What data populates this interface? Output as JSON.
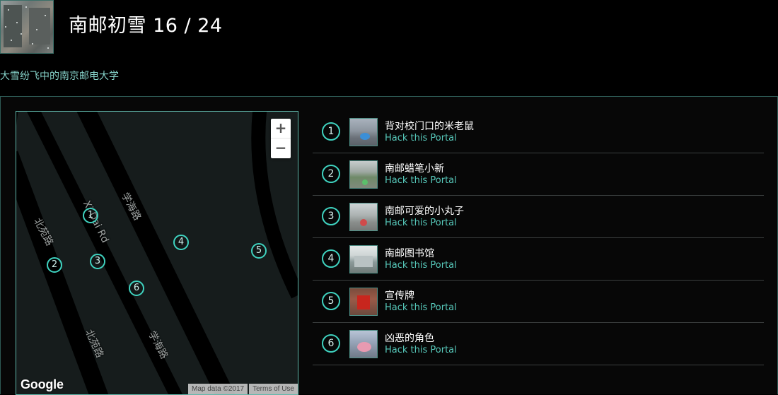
{
  "header": {
    "title": "南邮初雪 16 / 24",
    "subtitle": "大雪纷飞中的南京邮电大学"
  },
  "map": {
    "zoom_in": "+",
    "zoom_out": "−",
    "attribution": "Map data ©2017",
    "terms": "Terms of Use",
    "logo": "Google",
    "road_labels": [
      "北苑路",
      "Xi Dai Rd",
      "学海路",
      "北苑路",
      "学海路"
    ],
    "markers": [
      "1",
      "2",
      "3",
      "4",
      "5",
      "6"
    ],
    "colors": {
      "accent": "#3fd3c0",
      "road": "#000000",
      "land": "#161c1c"
    }
  },
  "portals": [
    {
      "num": "1",
      "name": "背对校门口的米老鼠",
      "link": "Hack this Portal"
    },
    {
      "num": "2",
      "name": "南邮蜡笔小新",
      "link": "Hack this Portal"
    },
    {
      "num": "3",
      "name": "南邮可爱的小丸子",
      "link": "Hack this Portal"
    },
    {
      "num": "4",
      "name": "南邮图书馆",
      "link": "Hack this Portal"
    },
    {
      "num": "5",
      "name": "宣传牌",
      "link": "Hack this Portal"
    },
    {
      "num": "6",
      "name": "凶恶的角色",
      "link": "Hack this Portal"
    }
  ]
}
